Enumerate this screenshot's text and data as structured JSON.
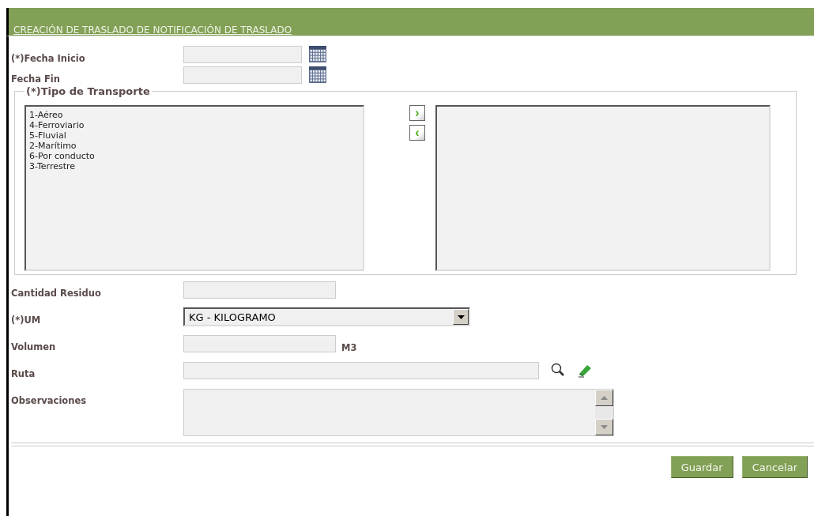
{
  "header": {
    "title": "CREACIÓN DE TRASLADO DE NOTIFICACIÓN DE TRASLADO"
  },
  "date_fields": [
    {
      "label": "(*)Fecha Inicio",
      "kind": "date"
    },
    {
      "label": "Fecha Fin",
      "kind": "date"
    }
  ],
  "transport": {
    "legend": "(*)Tipo de Transporte",
    "available": [
      "1-Aéreo",
      "4-Ferroviario",
      "5-Fluvial",
      "2-Marítimo",
      "6-Por conducto",
      "3-Terrestre"
    ],
    "move_right": "›",
    "move_left": "‹"
  },
  "fields": [
    {
      "label": "Cantidad Residuo",
      "kind": "text"
    },
    {
      "label": "(*)UM",
      "kind": "select",
      "value": "KG - KILOGRAMO"
    },
    {
      "label": "Volumen",
      "kind": "unit",
      "unit": "M3"
    },
    {
      "label": "Ruta",
      "kind": "lookup"
    },
    {
      "label": "Observaciones",
      "kind": "textarea"
    }
  ],
  "buttons": [
    "Guardar",
    "Cancelar"
  ]
}
